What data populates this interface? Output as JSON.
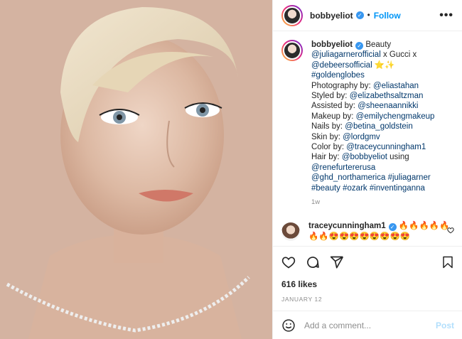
{
  "post": {
    "username": "bobbyeliot",
    "follow_label": "Follow",
    "dot": "•",
    "more_label": "•••",
    "caption": {
      "username": "bobbyeliot",
      "lines": [
        [
          {
            "t": "Beauty",
            "link": false
          }
        ],
        [
          {
            "t": "@juliagarnerofficial",
            "link": true
          },
          {
            "t": " x Gucci x",
            "link": false
          }
        ],
        [
          {
            "t": "@debeersofficial",
            "link": true
          },
          {
            "t": " ⭐✨",
            "link": false
          }
        ],
        [
          {
            "t": "#goldenglobes",
            "link": true
          }
        ],
        [
          {
            "t": "Photography by: ",
            "link": false
          },
          {
            "t": "@eliastahan",
            "link": true
          }
        ],
        [
          {
            "t": "Styled by: ",
            "link": false
          },
          {
            "t": "@elizabethsaltzman",
            "link": true
          }
        ],
        [
          {
            "t": "Assisted by: ",
            "link": false
          },
          {
            "t": "@sheenaannikki",
            "link": true
          }
        ],
        [
          {
            "t": "Makeup by: ",
            "link": false
          },
          {
            "t": "@emilychengmakeup",
            "link": true
          }
        ],
        [
          {
            "t": "Nails by: ",
            "link": false
          },
          {
            "t": "@betina_goldstein",
            "link": true
          }
        ],
        [
          {
            "t": "Skin by: ",
            "link": false
          },
          {
            "t": "@lordgmv",
            "link": true
          }
        ],
        [
          {
            "t": "Color by: ",
            "link": false
          },
          {
            "t": "@traceycunningham1",
            "link": true
          }
        ],
        [
          {
            "t": "Hair by: ",
            "link": false
          },
          {
            "t": "@bobbyeliot",
            "link": true
          },
          {
            "t": " using",
            "link": false
          }
        ],
        [
          {
            "t": "@renefurtererusa",
            "link": true
          }
        ],
        [
          {
            "t": "@ghd_northamerica",
            "link": true
          },
          {
            "t": " ",
            "link": false
          },
          {
            "t": "#juliagarner",
            "link": true
          }
        ],
        [
          {
            "t": "#beauty",
            "link": true
          },
          {
            "t": " ",
            "link": false
          },
          {
            "t": "#ozark",
            "link": true
          },
          {
            "t": " ",
            "link": false
          },
          {
            "t": "#inventinganna",
            "link": true
          }
        ]
      ],
      "time": "1w"
    },
    "comment": {
      "username": "traceycunningham1",
      "text": " 🔥🔥🔥🔥🔥🔥🔥😍😍😍😍😍😍😍😍"
    },
    "likes": "616 likes",
    "date": "JANUARY 12",
    "add_comment_placeholder": "Add a comment...",
    "post_label": "Post"
  },
  "colors": {
    "link": "#00376b",
    "follow": "#0095f6",
    "verified": "#3897f0"
  },
  "icons": [
    "heart-icon",
    "comment-icon",
    "share-icon",
    "bookmark-icon",
    "emoji-icon"
  ]
}
